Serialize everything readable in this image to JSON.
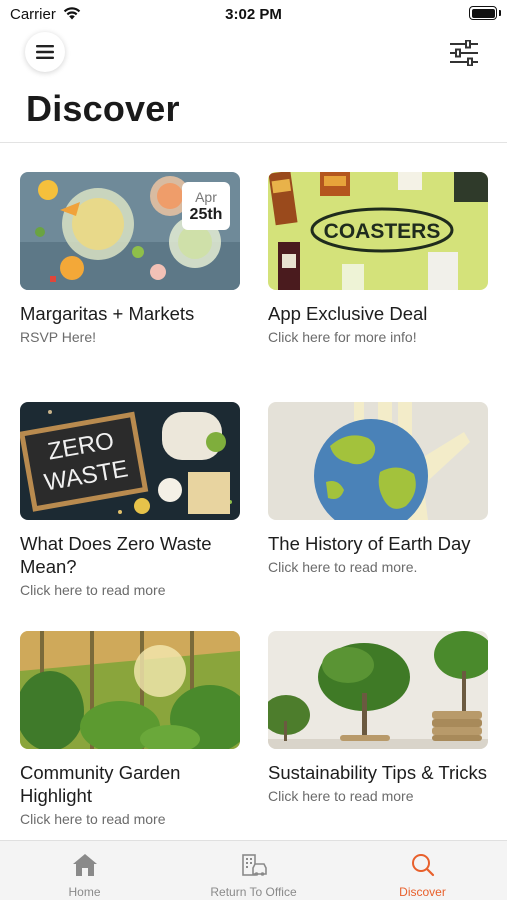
{
  "status_bar": {
    "carrier": "Carrier",
    "time": "3:02 PM"
  },
  "header": {
    "title": "Discover"
  },
  "cards": [
    {
      "title": "Margaritas + Markets",
      "subtitle": "RSVP Here!",
      "date_month": "Apr",
      "date_day": "25th"
    },
    {
      "title": "App Exclusive Deal",
      "subtitle": "Click here for more info!",
      "image_text": "COASTERS"
    },
    {
      "title": "What Does Zero Waste Mean?",
      "subtitle": "Click here to read more",
      "image_text_1": "ZERO",
      "image_text_2": "WASTE"
    },
    {
      "title": "The History of Earth Day",
      "subtitle": "Click here to read more."
    },
    {
      "title": "Community Garden Highlight",
      "subtitle": "Click here to read more"
    },
    {
      "title": "Sustainability Tips & Tricks",
      "subtitle": "Click here to read more"
    }
  ],
  "tab_bar": {
    "items": [
      {
        "label": "Home",
        "icon": "home-icon",
        "active": false
      },
      {
        "label": "Return To Office",
        "icon": "office-icon",
        "active": false
      },
      {
        "label": "Discover",
        "icon": "search-icon",
        "active": true
      }
    ]
  },
  "colors": {
    "accent": "#e8602c",
    "inactive": "#8a8a8a",
    "tab_bg": "#f4f4f4"
  }
}
